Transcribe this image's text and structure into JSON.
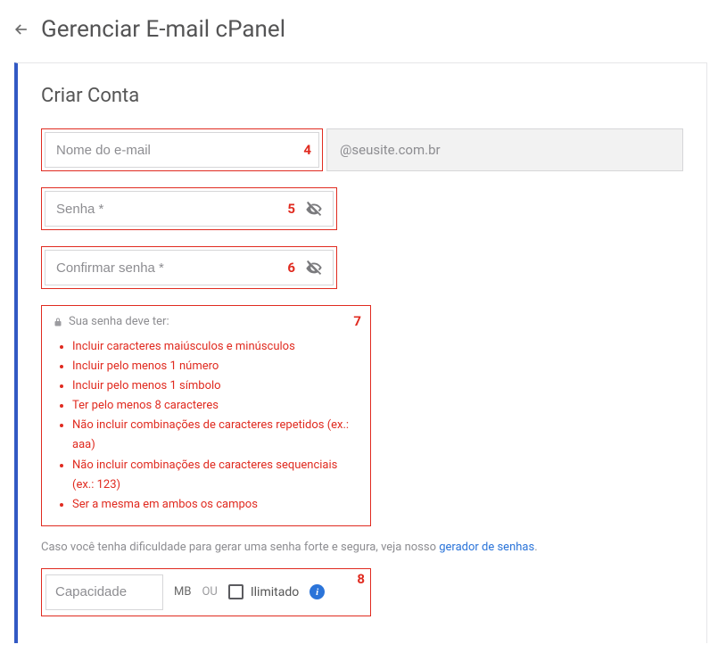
{
  "header": {
    "title": "Gerenciar E-mail cPanel"
  },
  "panel": {
    "title": "Criar Conta"
  },
  "email": {
    "name_placeholder": "Nome do e-mail",
    "domain": "@seusite.com.br",
    "annot": "4"
  },
  "password": {
    "placeholder": "Senha *",
    "annot": "5"
  },
  "confirm": {
    "placeholder": "Confirmar senha *",
    "annot": "6"
  },
  "rules": {
    "annot": "7",
    "heading": "Sua senha deve ter:",
    "items": [
      "Incluir caracteres maiúsculos e minúsculos",
      "Incluir pelo menos 1 número",
      "Incluir pelo menos 1 símbolo",
      "Ter pelo menos 8 caracteres",
      "Não incluir combinações de caracteres repetidos (ex.: aaa)",
      "Não incluir combinações de caracteres sequenciais (ex.: 123)",
      "Ser a mesma em ambos os campos"
    ]
  },
  "hint": {
    "text_before": "Caso você tenha dificuldade para gerar uma senha forte e segura, veja nosso ",
    "link": "gerador de senhas",
    "text_after": "."
  },
  "capacity": {
    "annot": "8",
    "placeholder": "Capacidade",
    "unit": "MB",
    "or": "OU",
    "unlimited": "Ilimitado"
  }
}
